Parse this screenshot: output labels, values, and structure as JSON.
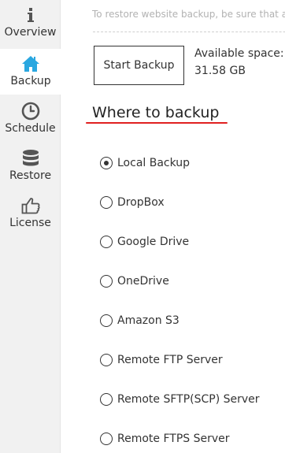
{
  "sidebar": {
    "items": [
      {
        "label": "Overview",
        "icon": "info-icon",
        "active": false
      },
      {
        "label": "Backup",
        "icon": "home-icon",
        "active": true
      },
      {
        "label": "Schedule",
        "icon": "clock-icon",
        "active": false
      },
      {
        "label": "Restore",
        "icon": "database-icon",
        "active": false
      },
      {
        "label": "License",
        "icon": "thumbs-up-icon",
        "active": false
      }
    ]
  },
  "main": {
    "notice": "To restore website backup, be sure that a",
    "start_backup_label": "Start Backup",
    "available_space_label": "Available space:",
    "available_space_value": "31.58 GB",
    "section_title": "Where to backup",
    "options": [
      {
        "label": "Local Backup",
        "selected": true
      },
      {
        "label": "DropBox",
        "selected": false
      },
      {
        "label": "Google Drive",
        "selected": false
      },
      {
        "label": "OneDrive",
        "selected": false
      },
      {
        "label": "Amazon S3",
        "selected": false
      },
      {
        "label": "Remote FTP Server",
        "selected": false
      },
      {
        "label": "Remote SFTP(SCP) Server",
        "selected": false
      },
      {
        "label": "Remote FTPS Server",
        "selected": false
      }
    ]
  },
  "colors": {
    "sidebar_bg": "#f1f1f1",
    "active_icon": "#2aa7e0",
    "icon": "#555555",
    "text": "#333333",
    "muted": "#b2b2b2",
    "underline": "#e02020"
  }
}
